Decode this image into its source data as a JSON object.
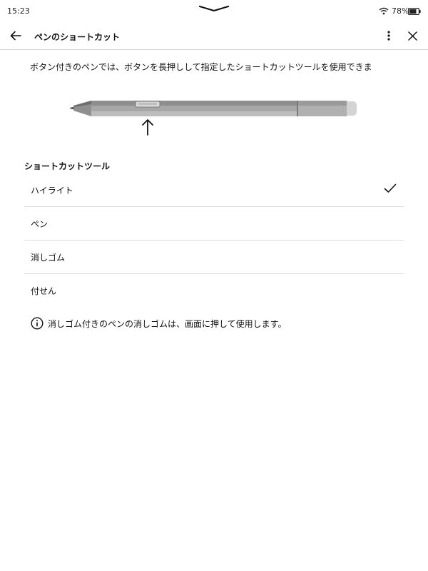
{
  "status_bar": {
    "time": "15:23",
    "battery_percent": "78%"
  },
  "header": {
    "title": "ペンのショートカット"
  },
  "content": {
    "description": "ボタン付きのペンでは、ボタンを長押しして指定したショートカットツールを使用できま",
    "section_heading": "ショートカットツール",
    "tools": [
      {
        "label": "ハイライト",
        "selected": true
      },
      {
        "label": "ペン",
        "selected": false
      },
      {
        "label": "消しゴム",
        "selected": false
      },
      {
        "label": "付せん",
        "selected": false
      }
    ],
    "info_text": "消しゴム付きのペンの消しゴムは、画面に押して使用します。"
  },
  "icons": {
    "back": "arrow-left-icon",
    "more": "more-vertical-icon",
    "close": "close-icon",
    "check": "check-icon",
    "info": "info-icon",
    "wifi": "wifi-icon",
    "battery": "battery-icon"
  }
}
